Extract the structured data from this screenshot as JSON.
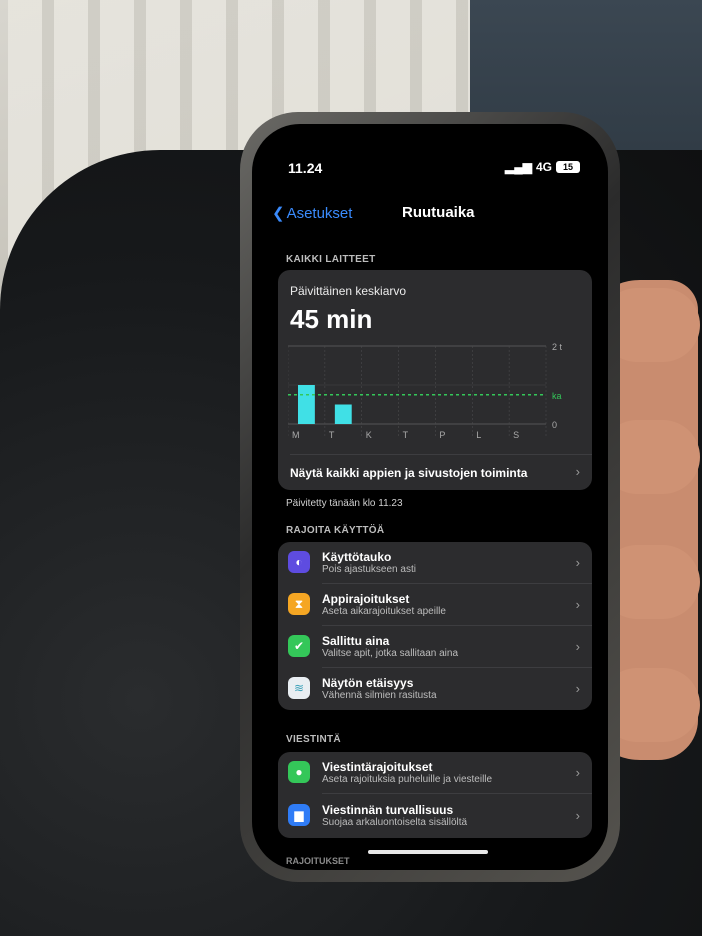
{
  "status_bar": {
    "time": "11.24",
    "network": "4G",
    "battery": "15"
  },
  "nav": {
    "back_label": "Asetukset",
    "title": "Ruutuaika"
  },
  "all_devices": {
    "section_label": "KAIKKI LAITTEET",
    "avg_label": "Päivittäinen keskiarvo",
    "avg_value": "45 min",
    "show_all_label": "Näytä kaikki appien ja sivustojen toiminta",
    "updated_text": "Päivitetty tänään klo 11.23"
  },
  "chart_data": {
    "type": "bar",
    "categories": [
      "M",
      "T",
      "K",
      "T",
      "P",
      "L",
      "S"
    ],
    "values": [
      60,
      30,
      0,
      0,
      0,
      0,
      0
    ],
    "ylim": [
      0,
      120
    ],
    "y_tick_labels": [
      "2 t",
      "0"
    ],
    "average_value": 45,
    "average_label": "ka",
    "bar_color": "#40e0e6",
    "average_color": "#34c759"
  },
  "restrict": {
    "section_label": "RAJOITA KÄYTTÖÄ",
    "items": [
      {
        "title": "Käyttötauko",
        "subtitle": "Pois ajastukseen asti",
        "icon": "downtime-icon",
        "color": "#5e4ce0"
      },
      {
        "title": "Appirajoitukset",
        "subtitle": "Aseta aikarajoitukset apeille",
        "icon": "hourglass-icon",
        "color": "#f5a623"
      },
      {
        "title": "Sallittu aina",
        "subtitle": "Valitse apit, jotka sallitaan aina",
        "icon": "check-icon",
        "color": "#34c759"
      },
      {
        "title": "Näytön etäisyys",
        "subtitle": "Vähennä silmien rasitusta",
        "icon": "screen-distance-icon",
        "color": "#e9eef2"
      }
    ]
  },
  "communication": {
    "section_label": "VIESTINTÄ",
    "items": [
      {
        "title": "Viestintärajoitukset",
        "subtitle": "Aseta rajoituksia puheluille ja viesteille",
        "icon": "contact-icon",
        "color": "#34c759"
      },
      {
        "title": "Viestinnän turvallisuus",
        "subtitle": "Suojaa arkaluontoiselta sisällöltä",
        "icon": "message-icon",
        "color": "#2f7cf6"
      }
    ]
  },
  "next_section_label": "RAJOITUKSET"
}
